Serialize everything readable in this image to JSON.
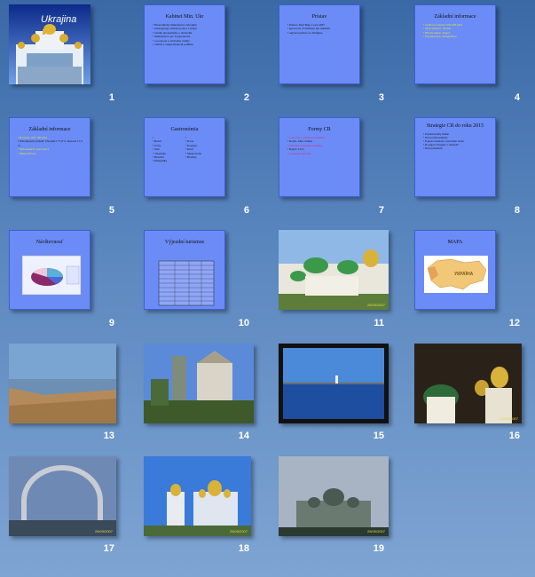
{
  "slides": [
    {
      "num": "1",
      "title": "Ukrajina"
    },
    {
      "num": "2",
      "title": "Kabinet Min. Ukr",
      "lines": [
        "Ekonomicky ministerstvo Ukrajiny",
        "zabezpecuje vnitrni prostor i vnejsi",
        "vztahy ekonomicke a obchodni",
        "ministerstvo pro hospodarstvi",
        "a rozpocet a obchodni vztahy",
        "vnitrni a vnejsi financni politiku"
      ]
    },
    {
      "num": "3",
      "title": "Pristav",
      "lines": [
        "Pristav Jizni Bug v roce 2007",
        "zpracoval 13 milionu tun nakladu",
        "nejvetsi pristav na Ukrajine"
      ]
    },
    {
      "num": "4",
      "title": "Základní informace",
      "lines": [
        "Celková rozloha: 603 628 km2",
        "Obyvatelstvo: 46 mil.",
        "Hlavní město: Kyjev",
        "Úřední jazyk: ukrajinština"
      ]
    },
    {
      "num": "5",
      "title": "Základní informace",
      "lines": [
        "Rozloha: 603 700 km2",
        "Národnostní složení: Ukrajinci 77,8 %, Rusové 17,3 %",
        "Náboženství: pravoslaví",
        "Měna: hřivna"
      ]
    },
    {
      "num": "6",
      "title": "Gastronómia",
      "col1": [
        "Borsč",
        "Ucha",
        "Salo",
        "Varenyky",
        "Holubci",
        "Pampušky"
      ],
      "col2": [
        "Kvas",
        "Kompot",
        "Kisil",
        "Medovucha",
        "Horilka"
      ]
    },
    {
      "num": "7",
      "title": "Formy CR",
      "lines": [
        "Letní CR a pobytová turistika",
        "Krym, Jalta, Oděsa",
        "Městská a kulturní turistika",
        "Kyjev, Lvov",
        "Lázeňská turistika"
      ]
    },
    {
      "num": "8",
      "title": "Strategie CR do roku 2015",
      "lines": [
        "Zvýšení kvality služeb",
        "Rozvoj infrastruktury",
        "Podpora domácího cestovního ruchu",
        "Propagace Ukrajiny v zahraničí",
        "Rozvoj lázeňství"
      ]
    },
    {
      "num": "9",
      "title": "Návštevnosť"
    },
    {
      "num": "10",
      "title": "Výjezdní turismus"
    },
    {
      "num": "11",
      "date": "25/09/2007"
    },
    {
      "num": "12",
      "title": "MAPA",
      "map_label": "УКРАЇНА"
    },
    {
      "num": "13"
    },
    {
      "num": "14"
    },
    {
      "num": "15"
    },
    {
      "num": "16",
      "date": "25/09/2007"
    },
    {
      "num": "17",
      "date": "25/09/2007"
    },
    {
      "num": "18",
      "date": "25/09/2007"
    },
    {
      "num": "19",
      "date": "25/09/2007"
    }
  ]
}
